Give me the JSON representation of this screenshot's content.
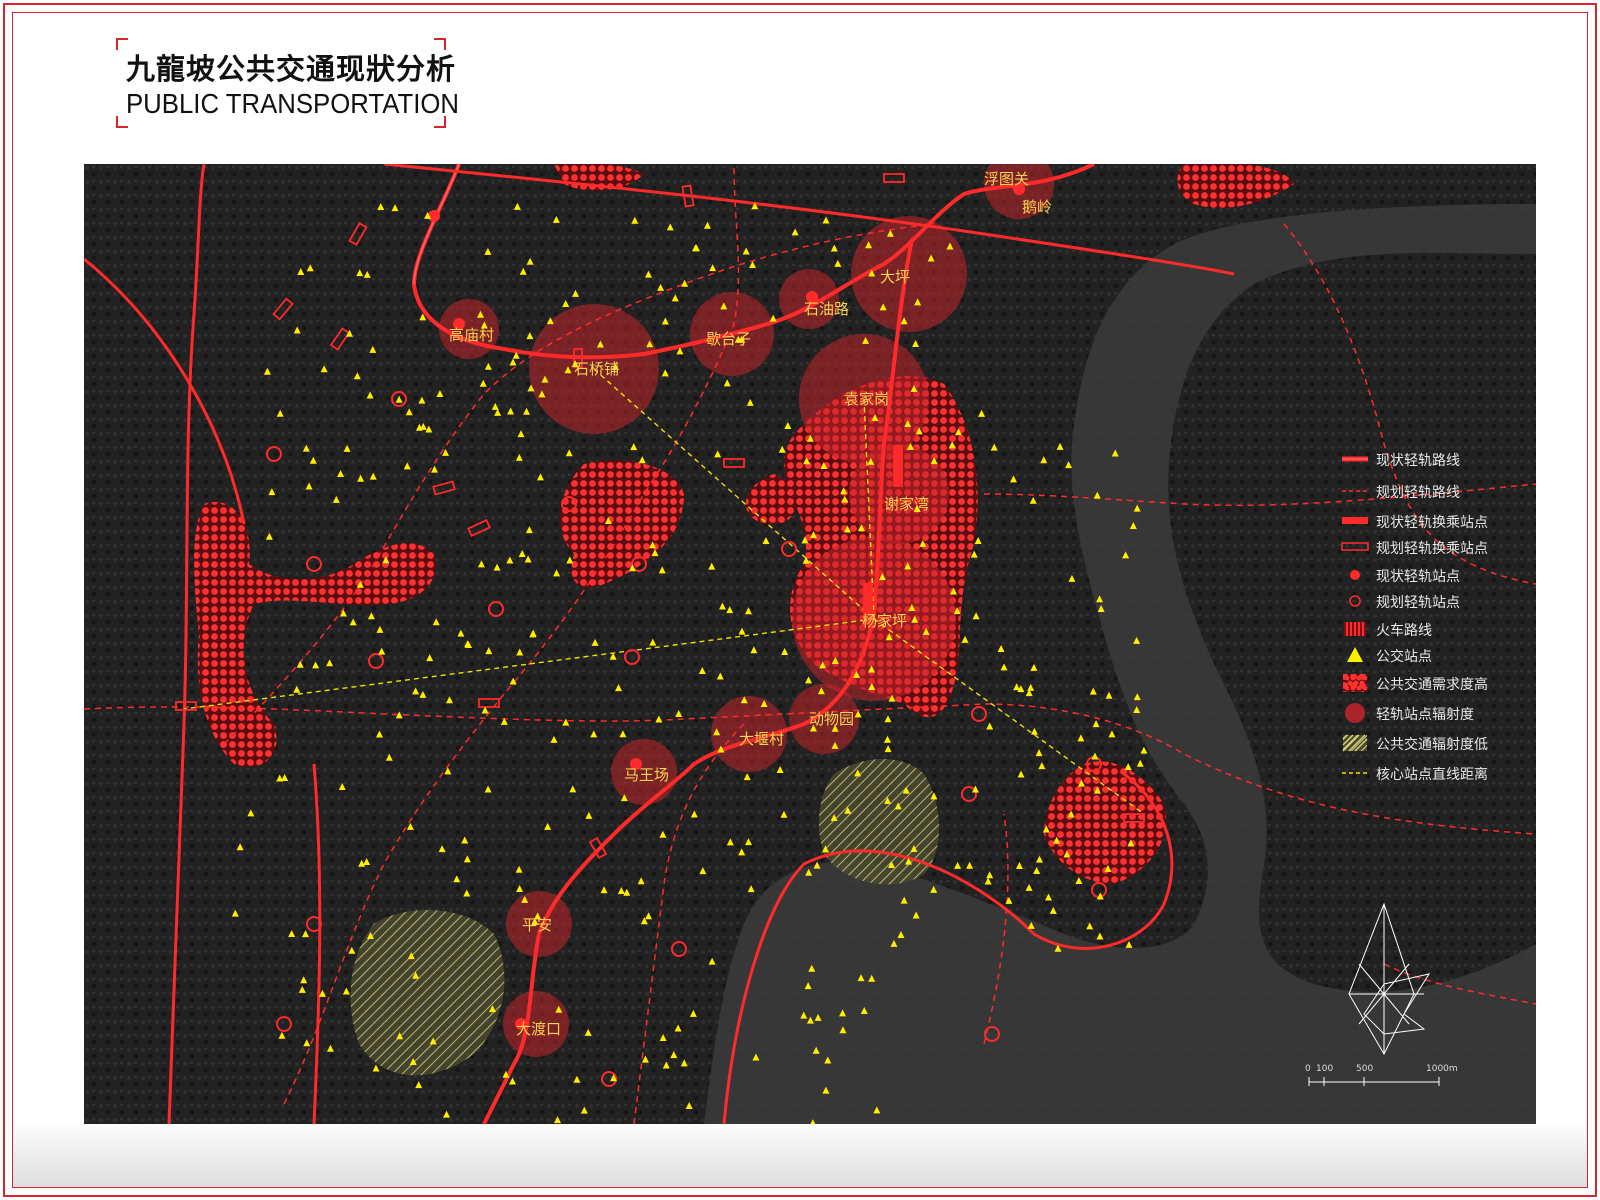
{
  "title": {
    "zh": "九龍坡公共交通现狀分析",
    "en": "PUBLIC TRANSPORTATION"
  },
  "colors": {
    "frame": "#d8252b",
    "rail": "#ff2a2a",
    "radius_fill": "#c2252b",
    "bus_stop": "#ffee00",
    "low_coverage": "#c8c86a",
    "map_bg": "#1b1b1b"
  },
  "stations": [
    {
      "name": "浮图关"
    },
    {
      "name": "鹅岭"
    },
    {
      "name": "大坪"
    },
    {
      "name": "石油路"
    },
    {
      "name": "歇台子"
    },
    {
      "name": "石桥铺"
    },
    {
      "name": "高庙村"
    },
    {
      "name": "袁家岗"
    },
    {
      "name": "谢家湾"
    },
    {
      "name": "杨家坪"
    },
    {
      "name": "动物园"
    },
    {
      "name": "大堰村"
    },
    {
      "name": "马王场"
    },
    {
      "name": "平安"
    },
    {
      "name": "大渡口"
    }
  ],
  "legend": [
    {
      "label": "现状轻轨路线",
      "icon": "existing-rail-line-icon"
    },
    {
      "label": "规划轻轨路线",
      "icon": "planned-rail-line-icon"
    },
    {
      "label": "现状轻轨换乘站点",
      "icon": "existing-transfer-station-icon"
    },
    {
      "label": "规划轻轨换乘站点",
      "icon": "planned-transfer-station-icon"
    },
    {
      "label": "现状轻轨站点",
      "icon": "existing-station-icon"
    },
    {
      "label": "规划轻轨站点",
      "icon": "planned-station-icon"
    },
    {
      "label": "火车路线",
      "icon": "railway-line-icon"
    },
    {
      "label": "公交站点",
      "icon": "bus-stop-icon"
    },
    {
      "label": "公共交通需求度高",
      "icon": "high-demand-icon"
    },
    {
      "label": "轻轨站点辐射度",
      "icon": "station-radius-icon"
    },
    {
      "label": "公共交通辐射度低",
      "icon": "low-coverage-icon"
    },
    {
      "label": "核心站点直线距离",
      "icon": "core-distance-line-icon"
    }
  ],
  "scalebar": {
    "ticks": [
      "0",
      "100",
      "500",
      "1000m"
    ]
  }
}
